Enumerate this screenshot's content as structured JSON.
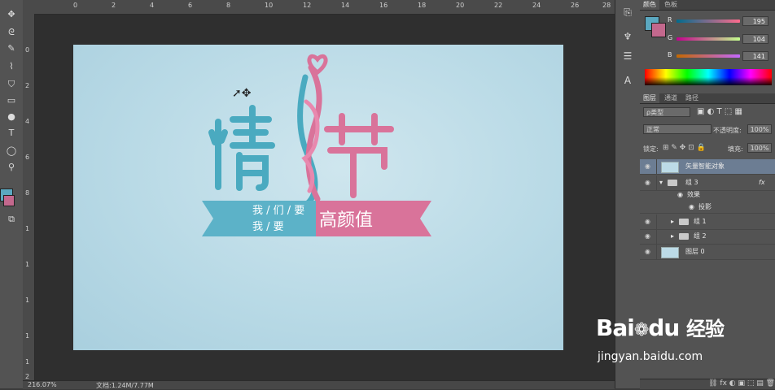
{
  "ruler_top": [
    "0",
    "2",
    "4",
    "6",
    "8",
    "10",
    "12",
    "14",
    "16",
    "18",
    "20",
    "22",
    "24",
    "26",
    "28"
  ],
  "ruler_left": [
    "0",
    "2",
    "4",
    "6",
    "8",
    "1",
    "1",
    "1",
    "1",
    "1",
    "2"
  ],
  "status": {
    "zoom": "216.07%",
    "doc": "文档:1.24M/7.77M"
  },
  "canvas_art": {
    "title_left": "情",
    "title_right": "节",
    "slogan_line1": "我 / 们 / 要",
    "slogan_line2": "我   /   要",
    "slogan_big": "高颜值",
    "teal": "#4aaac0",
    "pink": "#d9739a"
  },
  "color_panel": {
    "tabs": [
      "颜色",
      "色板"
    ],
    "channels": [
      {
        "label": "R",
        "value": "195"
      },
      {
        "label": "G",
        "value": "104"
      },
      {
        "label": "B",
        "value": "141"
      }
    ],
    "fg": "#5ba8c0",
    "bg": "#c3688d"
  },
  "layers_panel": {
    "tabs": [
      "图层",
      "通道",
      "路径"
    ],
    "filter": "ρ类型",
    "blend": "正常",
    "opacity_label": "不透明度:",
    "opacity": "100%",
    "lock_label": "锁定:",
    "fill_label": "填充:",
    "fill": "100%",
    "layers": [
      {
        "name": "矢量智能对象",
        "selected": true
      },
      {
        "name": "组 3"
      },
      {
        "name": "效果"
      },
      {
        "name": "投影"
      },
      {
        "name": "组 1"
      },
      {
        "name": "组 2"
      },
      {
        "name": "图层 0"
      }
    ],
    "fx": "fx"
  },
  "watermark": {
    "logo_a": "Bai",
    "logo_b": "du",
    "logo_c": "经验",
    "url": "jingyan.baidu.com"
  }
}
